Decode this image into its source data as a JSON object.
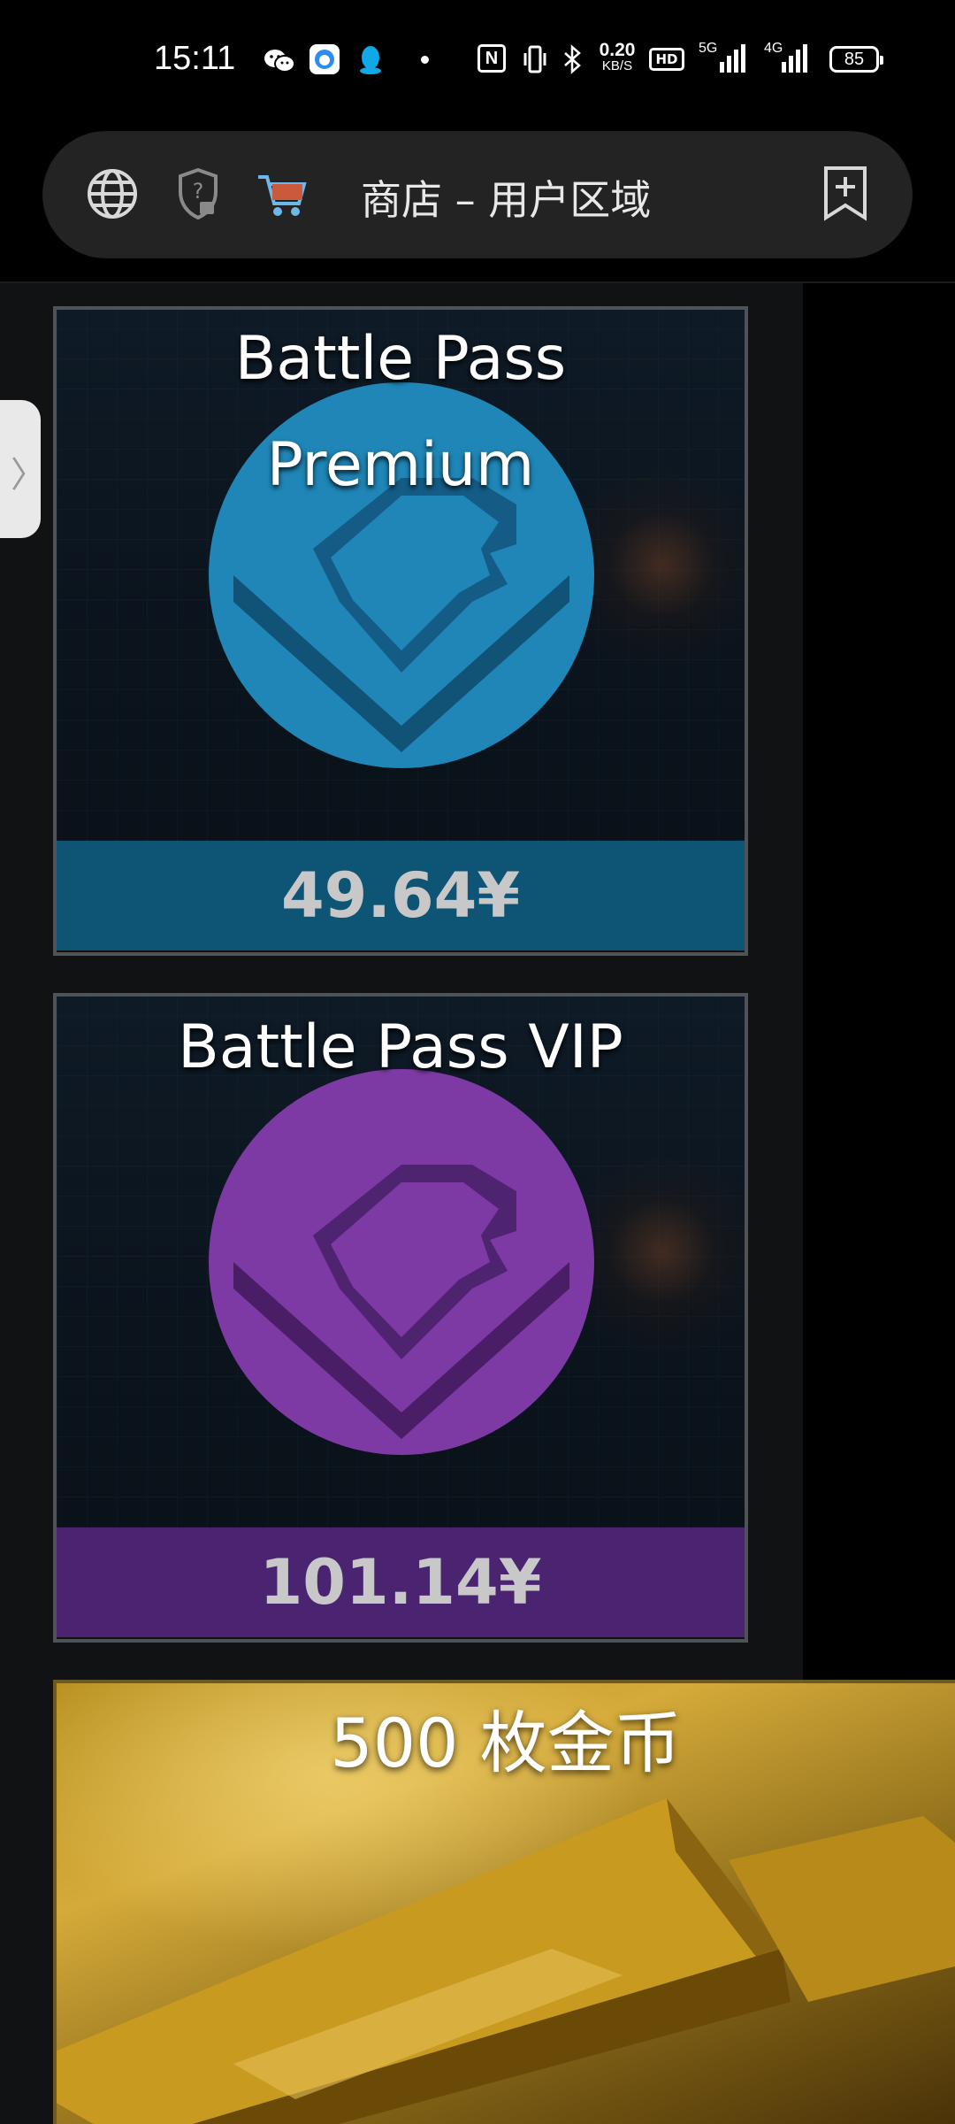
{
  "status_bar": {
    "time": "15:11",
    "net_speed_value": "0.20",
    "net_speed_unit": "KB/S",
    "hd_label": "HD",
    "net_5g": "5G",
    "net_4g": "4G",
    "battery": "85"
  },
  "address_bar": {
    "title": "商店 – 用户区域",
    "icons": [
      "globe-icon",
      "shield-lock-icon",
      "shopping-cart-icon",
      "bookmark-add-icon"
    ]
  },
  "products": [
    {
      "title": "Battle Pass Premium",
      "title_line1": "Battle Pass",
      "title_line2": "Premium",
      "price": "49.64¥",
      "accent": "#1f86b7",
      "bar_color": "#0d5475"
    },
    {
      "title": "Battle Pass VIP",
      "price": "101.14¥",
      "accent": "#7e3aa4",
      "bar_color": "#4a2470"
    },
    {
      "title": "500 枚金币"
    }
  ],
  "colors": {
    "background": "#000000",
    "address_bar": "#232323",
    "card_border": "#4f5358"
  }
}
